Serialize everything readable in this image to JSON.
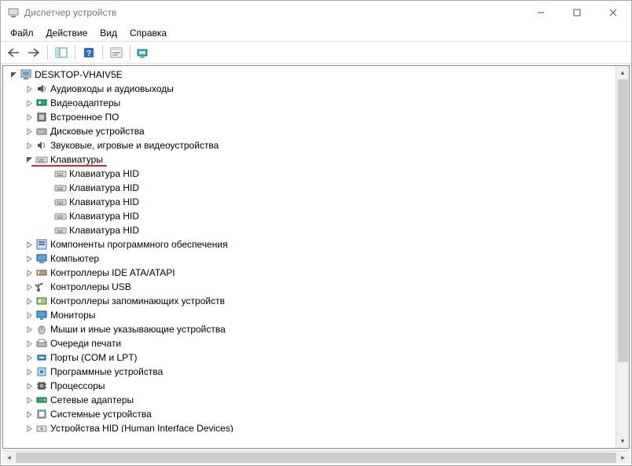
{
  "window": {
    "title": "Диспетчер устройств"
  },
  "menu": {
    "file": "Файл",
    "action": "Действие",
    "view": "Вид",
    "help": "Справка"
  },
  "tree": {
    "root": "DESKTOP-VHAIV5E",
    "nodes": [
      {
        "label": "Аудиовходы и аудиовыходы",
        "icon": "audio"
      },
      {
        "label": "Видеоадаптеры",
        "icon": "display-adapter"
      },
      {
        "label": "Встроенное ПО",
        "icon": "firmware"
      },
      {
        "label": "Дисковые устройства",
        "icon": "disk"
      },
      {
        "label": "Звуковые, игровые и видеоустройства",
        "icon": "sound"
      },
      {
        "label": "Клавиатуры",
        "icon": "keyboard",
        "expanded": true,
        "highlighted": true,
        "children": [
          {
            "label": "Клавиатура HID",
            "icon": "keyboard"
          },
          {
            "label": "Клавиатура HID",
            "icon": "keyboard"
          },
          {
            "label": "Клавиатура HID",
            "icon": "keyboard"
          },
          {
            "label": "Клавиатура HID",
            "icon": "keyboard"
          },
          {
            "label": "Клавиатура HID",
            "icon": "keyboard"
          }
        ]
      },
      {
        "label": "Компоненты программного обеспечения",
        "icon": "software"
      },
      {
        "label": "Компьютер",
        "icon": "computer"
      },
      {
        "label": "Контроллеры IDE ATA/ATAPI",
        "icon": "ide"
      },
      {
        "label": "Контроллеры USB",
        "icon": "usb"
      },
      {
        "label": "Контроллеры запоминающих устройств",
        "icon": "storage-ctrl"
      },
      {
        "label": "Мониторы",
        "icon": "monitor"
      },
      {
        "label": "Мыши и иные указывающие устройства",
        "icon": "mouse"
      },
      {
        "label": "Очереди печати",
        "icon": "print-queue"
      },
      {
        "label": "Порты (COM и LPT)",
        "icon": "port"
      },
      {
        "label": "Программные устройства",
        "icon": "soft-device"
      },
      {
        "label": "Процессоры",
        "icon": "cpu"
      },
      {
        "label": "Сетевые адаптеры",
        "icon": "network"
      },
      {
        "label": "Системные устройства",
        "icon": "system"
      },
      {
        "label": "Устройства HID (Human Interface Devices)",
        "icon": "hid",
        "clipped": true
      }
    ]
  }
}
